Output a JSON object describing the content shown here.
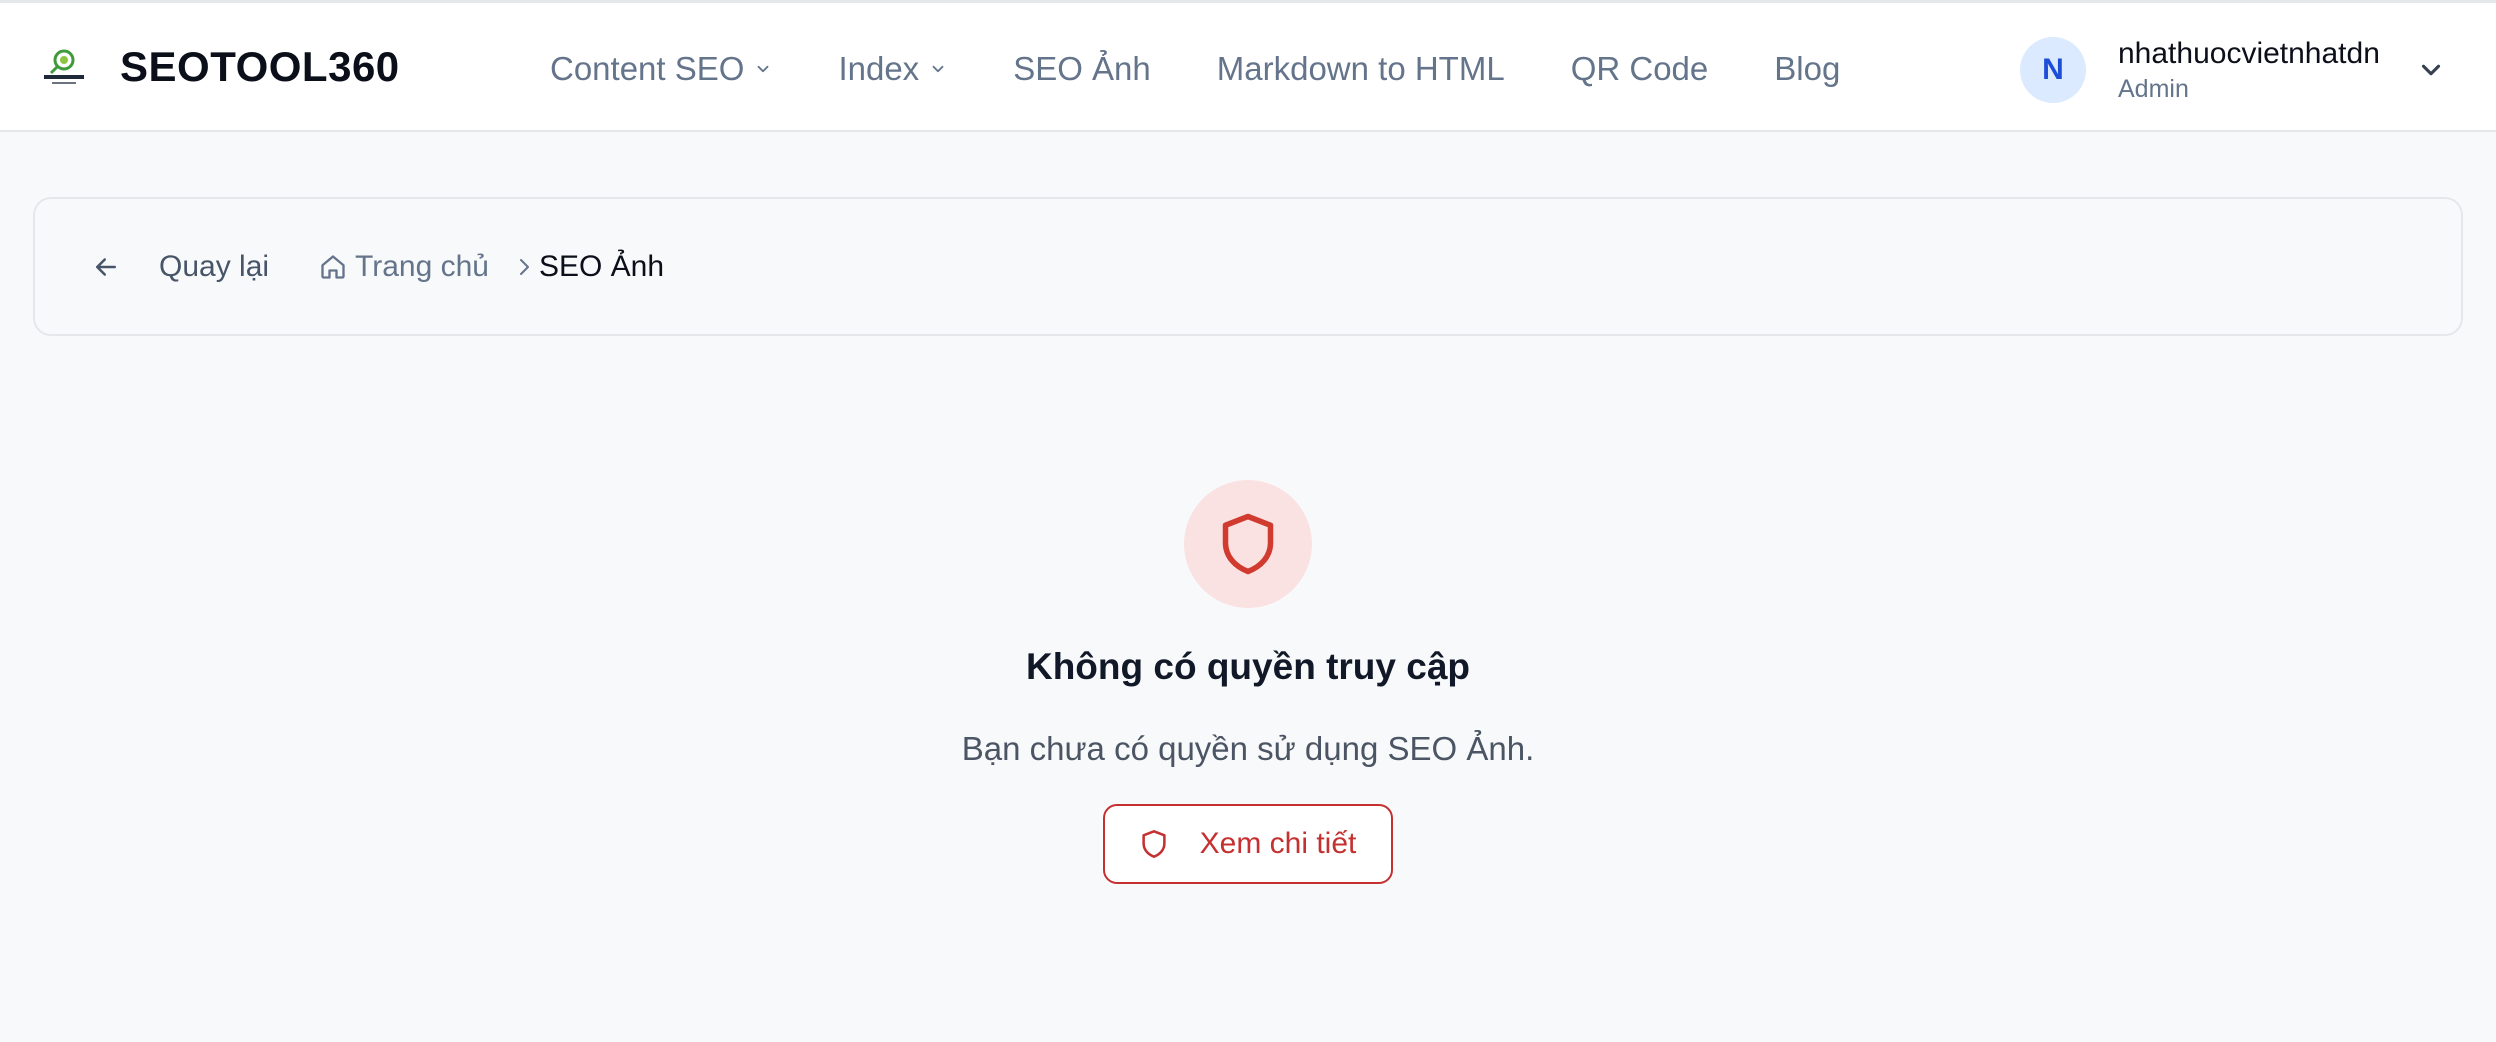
{
  "header": {
    "brand": "SEOTOOL360",
    "logo_icon": "magnifier-logo-icon",
    "nav": [
      {
        "label": "Content SEO",
        "has_dropdown": true
      },
      {
        "label": "Index",
        "has_dropdown": true
      },
      {
        "label": "SEO Ảnh",
        "has_dropdown": false
      },
      {
        "label": "Markdown to HTML",
        "has_dropdown": false
      },
      {
        "label": "QR Code",
        "has_dropdown": false
      },
      {
        "label": "Blog",
        "has_dropdown": false
      }
    ],
    "user": {
      "initial": "N",
      "name": "nhathuocvietnhatdn",
      "role": "Admin"
    }
  },
  "breadcrumb": {
    "back_label": "Quay lại",
    "home_label": "Trang chủ",
    "current": "SEO Ảnh"
  },
  "access_denied": {
    "title": "Không có quyền truy cập",
    "message": "Bạn chưa có quyền sử dụng SEO Ảnh.",
    "button_label": "Xem chi tiết"
  },
  "colors": {
    "accent_red": "#c53030",
    "shield_bg": "#fbe2e2",
    "avatar_bg": "#dbeafe",
    "avatar_text": "#1d4ed8",
    "muted_text": "#64748b",
    "page_bg": "#f8f9fb"
  }
}
